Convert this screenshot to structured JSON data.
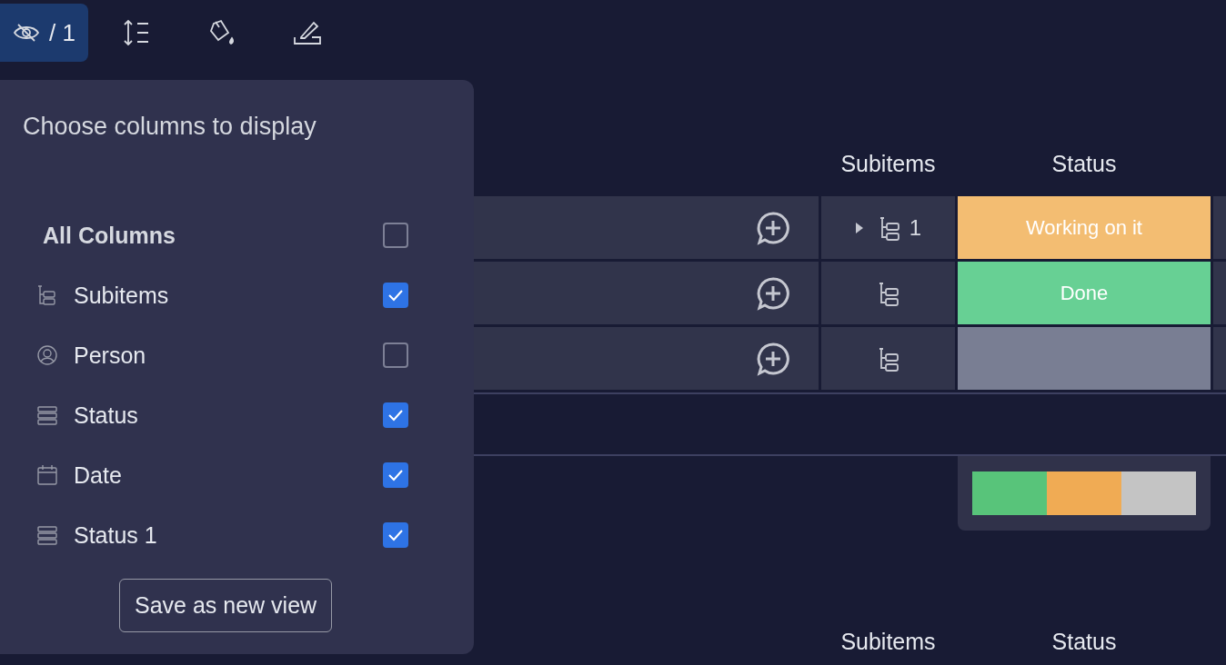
{
  "toolbar": {
    "buttons": [
      {
        "kind": "hide",
        "label": "/ 1",
        "selected": true
      },
      {
        "kind": "row-height",
        "selected": false
      },
      {
        "kind": "paint",
        "selected": false
      },
      {
        "kind": "format",
        "selected": false
      }
    ]
  },
  "group": {
    "columns": [
      "Subitems",
      "Status"
    ],
    "rows": [
      {
        "expandable": true,
        "subitems_count": "1",
        "status": {
          "label": "Working on it",
          "color": "#f3bd72"
        }
      },
      {
        "expandable": false,
        "status": {
          "label": "Done",
          "color": "#67d094"
        }
      },
      {
        "expandable": false,
        "status": {
          "color": "#797e93"
        }
      }
    ],
    "summary": [
      {
        "color": "#58c47a"
      },
      {
        "color": "#f0ab54"
      },
      {
        "color": "#c4c4c4"
      }
    ]
  },
  "next_group": {
    "columns": [
      "Subitems",
      "Status"
    ]
  },
  "popup": {
    "title": "Choose columns to display",
    "all_columns": {
      "label": "All Columns",
      "checked": false
    },
    "columns": [
      {
        "kind": "subitems",
        "label": "Subitems",
        "checked": true
      },
      {
        "kind": "person",
        "label": "Person",
        "checked": false
      },
      {
        "kind": "status",
        "label": "Status",
        "checked": true
      },
      {
        "kind": "date",
        "label": "Date",
        "checked": true
      },
      {
        "kind": "status",
        "label": "Status 1",
        "checked": true
      }
    ],
    "save_button": "Save as new view"
  }
}
